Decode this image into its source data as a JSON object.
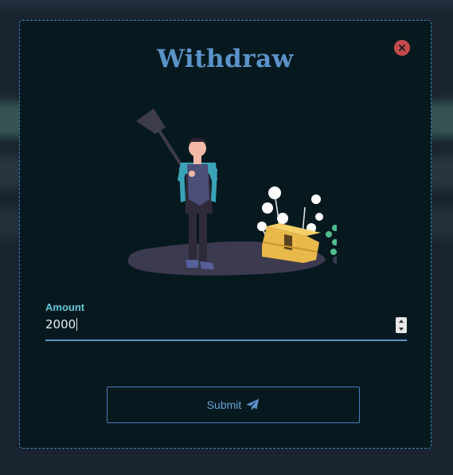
{
  "modal": {
    "title": "Withdraw",
    "close_icon": "close-icon",
    "illustration": "treasure-hunter-illustration"
  },
  "form": {
    "amount_label": "Amount",
    "amount_value": "2000",
    "submit_label": "Submit",
    "submit_icon": "paper-plane-icon"
  },
  "colors": {
    "accent": "#5b93c9",
    "label": "#5fc8d8",
    "close": "#c44a4e",
    "modal_bg": "#06191f"
  }
}
